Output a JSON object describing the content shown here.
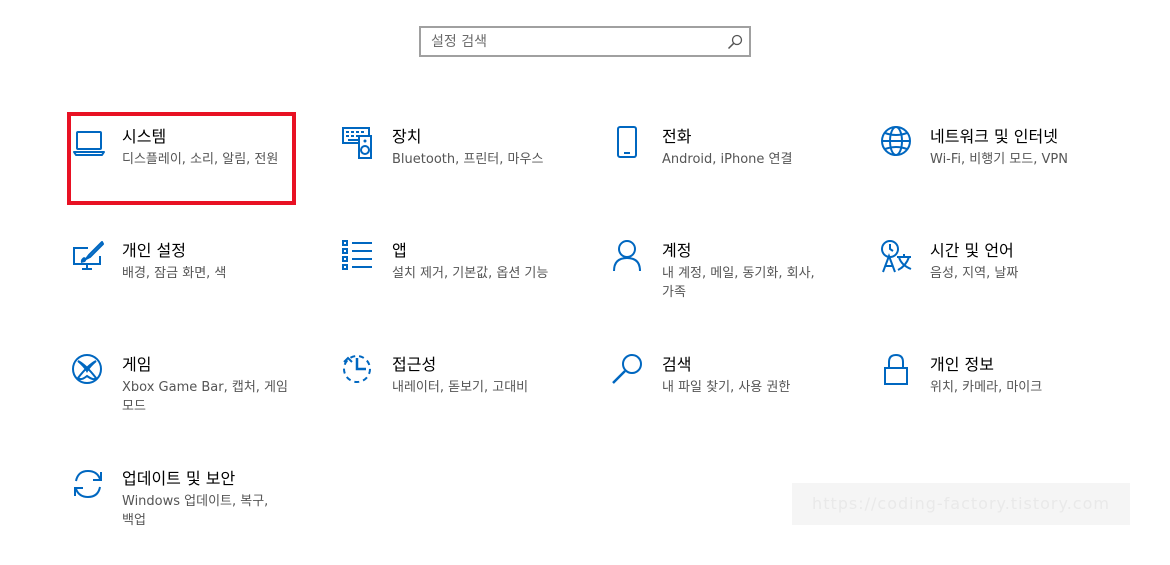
{
  "search": {
    "placeholder": "설정 검색",
    "icon": "search-icon"
  },
  "accent_color": "#0067c0",
  "highlight_color": "#e81123",
  "watermark": "https://coding-factory.tistory.com",
  "tiles": [
    {
      "title": "시스템",
      "desc": "디스플레이, 소리, 알림, 전원",
      "icon": "laptop-icon"
    },
    {
      "title": "장치",
      "desc": "Bluetooth, 프린터, 마우스",
      "icon": "keyboard-speaker-icon"
    },
    {
      "title": "전화",
      "desc": "Android, iPhone 연결",
      "icon": "phone-icon"
    },
    {
      "title": "네트워크 및 인터넷",
      "desc": "Wi-Fi, 비행기 모드, VPN",
      "icon": "globe-icon"
    },
    {
      "title": "개인 설정",
      "desc": "배경, 잠금 화면, 색",
      "icon": "paint-monitor-icon"
    },
    {
      "title": "앱",
      "desc": "설치 제거, 기본값, 옵션 기능",
      "icon": "apps-list-icon"
    },
    {
      "title": "계정",
      "desc": "내 계정, 메일, 동기화, 회사, 가족",
      "icon": "person-icon"
    },
    {
      "title": "시간 및 언어",
      "desc": "음성, 지역, 날짜",
      "icon": "time-language-icon"
    },
    {
      "title": "게임",
      "desc": "Xbox Game Bar, 캡처, 게임 모드",
      "icon": "xbox-icon"
    },
    {
      "title": "접근성",
      "desc": "내레이터, 돋보기, 고대비",
      "icon": "ease-of-access-icon"
    },
    {
      "title": "검색",
      "desc": "내 파일 찾기, 사용 권한",
      "icon": "magnifier-icon"
    },
    {
      "title": "개인 정보",
      "desc": "위치, 카메라, 마이크",
      "icon": "lock-icon"
    },
    {
      "title": "업데이트 및 보안",
      "desc": "Windows 업데이트, 복구, 백업",
      "icon": "sync-icon"
    }
  ]
}
